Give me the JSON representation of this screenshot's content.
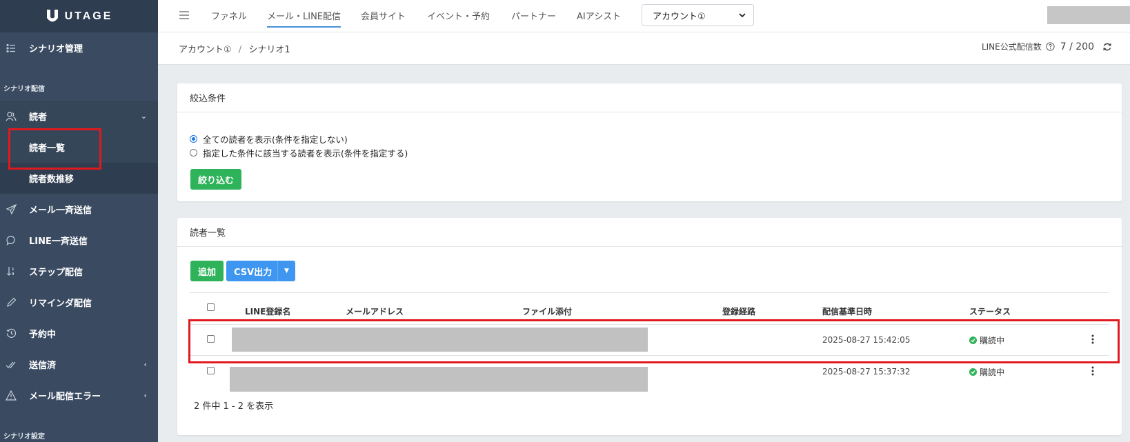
{
  "app": {
    "logo_text": "UTAGE"
  },
  "topbar": {
    "nav": [
      "ファネル",
      "メール・LINE配信",
      "会員サイト",
      "イベント・予約",
      "パートナー",
      "AIアシスト"
    ],
    "account_select": "アカウント①"
  },
  "sidebar": {
    "scenario_manage": "シナリオ管理",
    "section_delivery": "シナリオ配信",
    "readers": "読者",
    "reader_list": "読者一覧",
    "reader_trend": "読者数推移",
    "mail_bulk": "メール一斉送信",
    "line_bulk": "LINE一斉送信",
    "step": "ステップ配信",
    "remind": "リマインダ配信",
    "reserved": "予約中",
    "sent": "送信済",
    "mail_error": "メール配信エラー",
    "section_settings": "シナリオ設定"
  },
  "breadcrumb": {
    "account": "アカウント①",
    "sep": "/",
    "scenario": "シナリオ1"
  },
  "line_count": {
    "label": "LINE公式配信数",
    "value": "7 / 200"
  },
  "filter": {
    "title": "絞込条件",
    "option_all": "全ての読者を表示(条件を指定しない)",
    "option_cond": "指定した条件に該当する読者を表示(条件を指定する)",
    "submit": "絞り込む"
  },
  "list": {
    "title": "読者一覧",
    "add": "追加",
    "csv": "CSV出力",
    "columns": [
      "LINE登録名",
      "メールアドレス",
      "ファイル添付",
      "登録経路",
      "配信基準日時",
      "ステータス"
    ],
    "rows": [
      {
        "date": "2025-08-27 15:42:05",
        "status": "購読中"
      },
      {
        "date": "2025-08-27 15:37:32",
        "status": "購読中"
      }
    ],
    "pager": "2 件中 1 - 2 を表示"
  }
}
